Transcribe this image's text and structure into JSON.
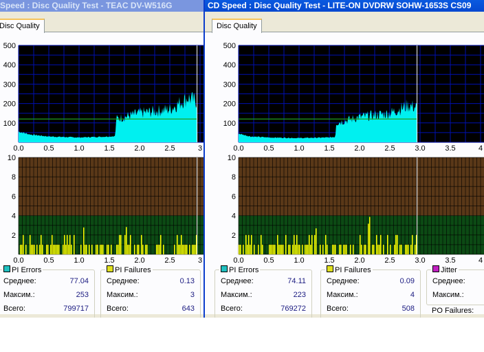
{
  "windows": [
    {
      "title": "Speed : Disc Quality Test - TEAC    DV-W516G",
      "tab": "Disc Quality",
      "groups": [
        {
          "legend": "PI Errors",
          "color": "#20c0c0",
          "rows": [
            {
              "label": "Среднее:",
              "value": "77.04"
            },
            {
              "label": "Максим.:",
              "value": "253"
            },
            {
              "label": "Всего:",
              "value": "799717"
            }
          ]
        },
        {
          "legend": "PI Failures",
          "color": "#e0e020",
          "rows": [
            {
              "label": "Среднее:",
              "value": "0.13"
            },
            {
              "label": "Максим.:",
              "value": "3"
            },
            {
              "label": "Всего:",
              "value": "643"
            }
          ]
        }
      ]
    },
    {
      "title": "CD Speed : Disc Quality Test - LITE-ON DVDRW SOHW-1653S CS09",
      "tab": "Disc Quality",
      "groups": [
        {
          "legend": "PI Errors",
          "color": "#20c0c0",
          "rows": [
            {
              "label": "Среднее:",
              "value": "74.11"
            },
            {
              "label": "Максим.:",
              "value": "223"
            },
            {
              "label": "Всего:",
              "value": "769272"
            }
          ]
        },
        {
          "legend": "PI Failures",
          "color": "#e0e020",
          "rows": [
            {
              "label": "Среднее:",
              "value": "0.09"
            },
            {
              "label": "Максим.:",
              "value": "4"
            },
            {
              "label": "Всего:",
              "value": "508"
            }
          ]
        },
        {
          "legend": "Jitter",
          "color": "#c020c0",
          "rows": [
            {
              "label": "Среднее:",
              "value": ""
            },
            {
              "label": "Максим.:",
              "value": ""
            }
          ]
        }
      ],
      "po_failures_label": "PO Failures:"
    }
  ],
  "chart_data": [
    {
      "type": "area",
      "title": "PI Errors (TEAC)",
      "x_ticks": [
        "0.0",
        "0.5",
        "1.0",
        "1.5",
        "2.0",
        "2.5",
        "3"
      ],
      "y_ticks": [
        "100",
        "200",
        "300",
        "400",
        "500"
      ],
      "xlim": [
        0,
        3
      ],
      "ylim": [
        0,
        500
      ],
      "x": [
        0,
        0.2,
        0.5,
        1.0,
        1.5,
        1.6,
        1.61,
        2.0,
        2.5,
        2.8,
        2.95
      ],
      "y": [
        55,
        40,
        30,
        25,
        30,
        32,
        120,
        150,
        170,
        230,
        210
      ],
      "speed_line": 120,
      "end": 2.95
    },
    {
      "type": "bar",
      "title": "PI Failures (TEAC)",
      "x_ticks": [
        "0.0",
        "0.5",
        "1.0",
        "1.5",
        "2.0",
        "2.5",
        "3"
      ],
      "y_ticks": [
        "2",
        "4",
        "6",
        "8",
        "10"
      ],
      "xlim": [
        0,
        3
      ],
      "ylim": [
        0,
        10
      ],
      "typical": 1,
      "max": 3,
      "end": 2.95
    },
    {
      "type": "area",
      "title": "PI Errors (LITE-ON)",
      "x_ticks": [
        "0.0",
        "0.5",
        "1.0",
        "1.5",
        "2.0",
        "2.5",
        "3.0",
        "3.5",
        "4"
      ],
      "y_ticks": [
        "100",
        "200",
        "300",
        "400",
        "500"
      ],
      "xlim": [
        0,
        4
      ],
      "ylim": [
        0,
        500
      ],
      "x": [
        0,
        0.2,
        0.5,
        1.0,
        1.5,
        1.6,
        1.61,
        2.0,
        2.5,
        2.8,
        2.95
      ],
      "y": [
        45,
        30,
        25,
        22,
        25,
        28,
        100,
        130,
        150,
        190,
        180
      ],
      "speed_line": 120,
      "end": 2.95
    },
    {
      "type": "bar",
      "title": "PI Failures (LITE-ON)",
      "x_ticks": [
        "0.0",
        "0.5",
        "1.0",
        "1.5",
        "2.0",
        "2.5",
        "3.0",
        "3.5",
        "4"
      ],
      "y_ticks": [
        "2",
        "4",
        "6",
        "8",
        "10"
      ],
      "xlim": [
        0,
        4
      ],
      "ylim": [
        0,
        10
      ],
      "typical": 1,
      "max": 4,
      "end": 2.95
    }
  ]
}
